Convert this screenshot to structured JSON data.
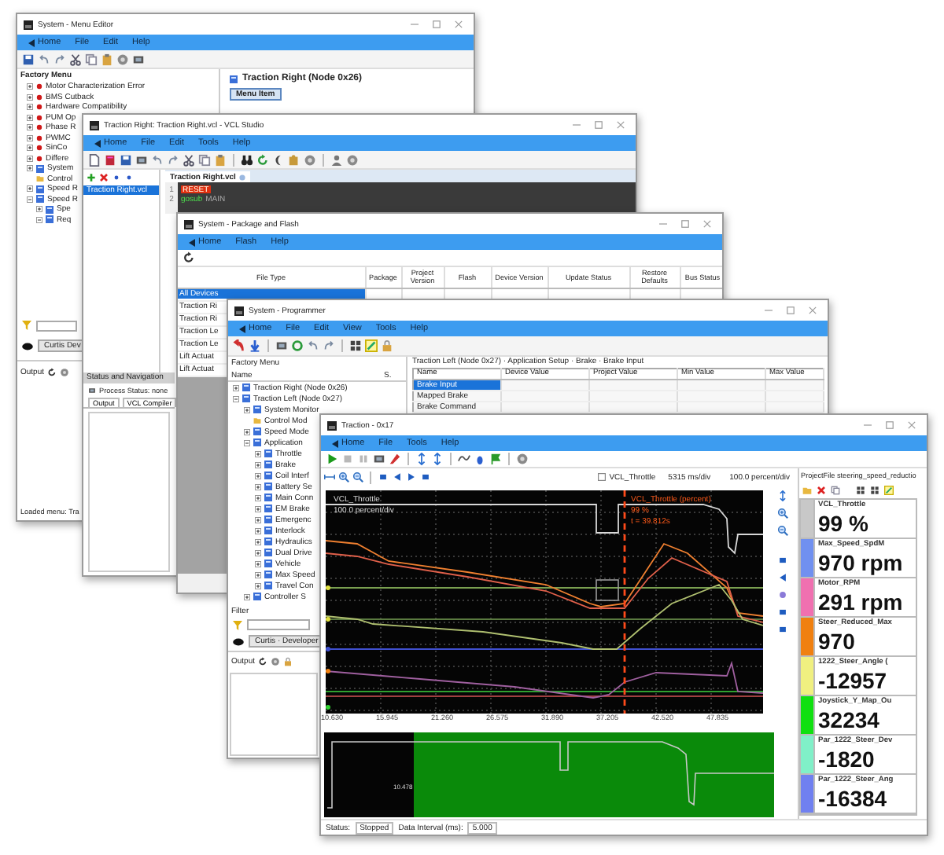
{
  "menu_editor": {
    "title": "System - Menu Editor",
    "menu": [
      "Home",
      "File",
      "Edit",
      "Help"
    ],
    "panel_title": "Factory Menu",
    "tree": [
      {
        "label": "Motor Characterization Error",
        "kind": "fault",
        "expanded": false
      },
      {
        "label": "BMS Cutback",
        "kind": "fault",
        "expanded": false
      },
      {
        "label": "Hardware Compatibility",
        "kind": "fault",
        "expanded": false
      },
      {
        "label": "PUM Op",
        "kind": "fault",
        "expanded": false
      },
      {
        "label": "Phase R",
        "kind": "fault",
        "expanded": false
      },
      {
        "label": "PWMC",
        "kind": "fault",
        "expanded": false
      },
      {
        "label": "SinCo",
        "kind": "fault",
        "expanded": false
      },
      {
        "label": "Differe",
        "kind": "fault",
        "expanded": false
      },
      {
        "label": "System",
        "kind": "group",
        "expanded": false
      },
      {
        "label": "Control",
        "kind": "setting"
      },
      {
        "label": "Speed R",
        "kind": "group",
        "expanded": false
      },
      {
        "label": "Speed R",
        "kind": "group",
        "expanded": true,
        "children": [
          {
            "label": "Spe",
            "kind": "group",
            "expanded": false
          },
          {
            "label": "Req",
            "kind": "group",
            "expanded": true
          }
        ]
      }
    ],
    "node_title": "Traction Right (Node 0x26)",
    "node_button": "Menu Item",
    "profile": "Curtis Dev",
    "output_label": "Output",
    "status": "Loaded menu: Tra"
  },
  "vcl_studio": {
    "title": "Traction Right: Traction Right.vcl - VCL Studio",
    "menu": [
      "Home",
      "File",
      "Edit",
      "Tools",
      "Help"
    ],
    "files": [
      {
        "label": "Traction Right.vcl",
        "selected": true
      }
    ],
    "tab": "Traction Right.vcl",
    "code": [
      {
        "number": "1",
        "tokens": [
          {
            "text": "RESET",
            "kind": "error"
          }
        ]
      },
      {
        "number": "2",
        "tokens": [
          {
            "text": "gosub",
            "kind": "keyword"
          },
          {
            "text": "MAIN",
            "kind": "name"
          }
        ]
      }
    ],
    "dock_title": "Status and Navigation",
    "process_status": "Process Status: none",
    "dock_tabs": [
      "Output",
      "VCL Compiler"
    ]
  },
  "package_flash": {
    "title": "System - Package and Flash",
    "menu": [
      "Home",
      "Flash",
      "Help"
    ],
    "columns": [
      "File Type",
      "Package",
      "Project Version",
      "Flash",
      "Device Version",
      "Update Status",
      "Restore Defaults",
      "Bus Status"
    ],
    "rows": [
      {
        "label": "All Devices",
        "selected": true
      },
      {
        "label": "Traction Ri",
        "selected": false
      },
      {
        "label": "Traction Ri",
        "selected": false
      },
      {
        "label": "Traction Le",
        "selected": false
      },
      {
        "label": "Traction Le",
        "selected": false
      },
      {
        "label": "Lift Actuat",
        "selected": false
      },
      {
        "label": "Lift Actuat",
        "selected": false
      }
    ]
  },
  "programmer": {
    "title": "System - Programmer",
    "menu": [
      "Home",
      "File",
      "Edit",
      "View",
      "Tools",
      "Help"
    ],
    "panel_title": "Factory Menu",
    "name_header": "Name",
    "sort_header": "S.",
    "tree": [
      {
        "label": "Traction Right (Node 0x26)",
        "kind": "group",
        "expanded": false
      },
      {
        "label": "Traction Left (Node 0x27)",
        "kind": "group",
        "expanded": true,
        "children": [
          {
            "label": "System Monitor",
            "kind": "group",
            "expanded": false
          },
          {
            "label": "Control Mod",
            "kind": "setting"
          },
          {
            "label": "Speed Mode",
            "kind": "group",
            "expanded": false
          },
          {
            "label": "Application",
            "kind": "group",
            "expanded": true,
            "children": [
              {
                "label": "Throttle",
                "kind": "group",
                "expanded": false
              },
              {
                "label": "Brake",
                "kind": "group",
                "expanded": false
              },
              {
                "label": "Coil Interf",
                "kind": "group",
                "expanded": false
              },
              {
                "label": "Battery Se",
                "kind": "group",
                "expanded": false
              },
              {
                "label": "Main Conn",
                "kind": "group",
                "expanded": false
              },
              {
                "label": "EM Brake",
                "kind": "group",
                "expanded": false
              },
              {
                "label": "Emergenc",
                "kind": "group",
                "expanded": false
              },
              {
                "label": "Interlock",
                "kind": "group",
                "expanded": false
              },
              {
                "label": "Hydraulics",
                "kind": "group",
                "expanded": false
              },
              {
                "label": "Dual Drive",
                "kind": "group",
                "expanded": false
              },
              {
                "label": "Vehicle",
                "kind": "group",
                "expanded": false
              },
              {
                "label": "Max Speed",
                "kind": "group",
                "expanded": false
              },
              {
                "label": "Travel Con",
                "kind": "group",
                "expanded": false
              }
            ]
          },
          {
            "label": "Controller S",
            "kind": "group",
            "expanded": false
          }
        ]
      }
    ],
    "filter_label": "Filter",
    "profile": "Curtis · Developer",
    "output_label": "Output",
    "breadcrumb": "Traction Left (Node 0x27) · Application Setup · Brake · Brake Input",
    "columns": [
      "Name",
      "Device Value",
      "Project Value",
      "Min Value",
      "Max Value"
    ],
    "rows": [
      {
        "name": "Brake Input",
        "selected": true
      },
      {
        "name": "Mapped Brake",
        "selected": false
      },
      {
        "name": "Brake Command",
        "selected": false
      }
    ]
  },
  "trace": {
    "title": "Traction - 0x17",
    "menu": [
      "Home",
      "File",
      "Tools",
      "Help"
    ],
    "channel_checked": false,
    "channel": "VCL_Throttle",
    "time_scale": "5315 ms/div",
    "value_scale": "100.0 percent/div",
    "overlay_name": "VCL_Throttle",
    "overlay_scale": "100.0 percent/div",
    "cursor_label": "VCL_Throttle (percent)",
    "cursor_value": "99 %",
    "cursor_time": "t = 39.812s",
    "x_ticks": [
      "10.630",
      "15.945",
      "21.260",
      "26.575",
      "31.890",
      "37.205",
      "42.520",
      "47.835"
    ],
    "overview_label": "10.478",
    "panel_title": "ProjectFile steering_speed_reductio",
    "gauges": [
      {
        "name": "VCL_Throttle",
        "value": "99 %",
        "color": "#c8c8c8"
      },
      {
        "name": "Max_Speed_SpdM",
        "value": "970 rpm",
        "color": "#7090f0"
      },
      {
        "name": "Motor_RPM",
        "value": "291 rpm",
        "color": "#f070b0"
      },
      {
        "name": "Steer_Reduced_Max",
        "value": "970",
        "color": "#f08010"
      },
      {
        "name": "1222_Steer_Angle (",
        "value": "-12957",
        "color": "#f0f080"
      },
      {
        "name": "Joystick_Y_Map_Ou",
        "value": "32234",
        "color": "#10e010"
      },
      {
        "name": "Par_1222_Steer_Dev",
        "value": "-1820",
        "color": "#80f0c8"
      },
      {
        "name": "Par_1222_Steer_Ang",
        "value": "-16384",
        "color": "#7080f0"
      }
    ],
    "status": [
      {
        "text": "Status:",
        "kind": "label"
      },
      {
        "text": "Stopped",
        "kind": "field"
      },
      {
        "text": "Data Interval (ms):",
        "kind": "label"
      },
      {
        "text": "5.000",
        "kind": "field"
      }
    ]
  }
}
